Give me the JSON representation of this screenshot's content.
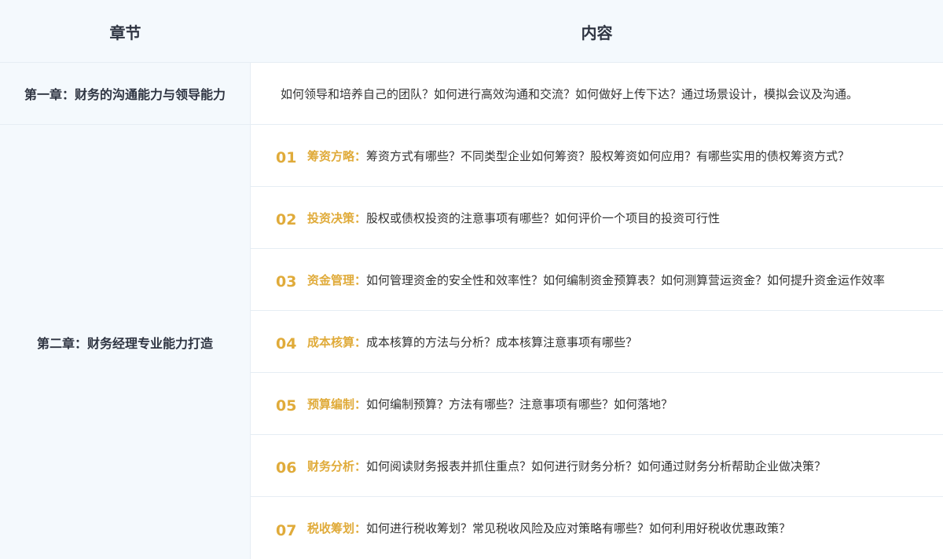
{
  "header": {
    "chapter_label": "章节",
    "content_label": "内容"
  },
  "chapters": [
    {
      "title": "第一章：财务的沟通能力与领导能力",
      "content": "如何领导和培养自己的团队？如何进行高效沟通和交流？如何做好上传下达？通过场景设计，模拟会议及沟通。"
    },
    {
      "title": "第二章：财务经理专业能力打造",
      "items": [
        {
          "num": "01",
          "topic": "筹资方略：",
          "desc": "筹资方式有哪些？不同类型企业如何筹资？股权筹资如何应用？有哪些实用的债权筹资方式？"
        },
        {
          "num": "02",
          "topic": "投资决策：",
          "desc": "股权或债权投资的注意事项有哪些？如何评价一个项目的投资可行性"
        },
        {
          "num": "03",
          "topic": "资金管理：",
          "desc": "如何管理资金的安全性和效率性？如何编制资金预算表？如何测算营运资金？如何提升资金运作效率"
        },
        {
          "num": "04",
          "topic": "成本核算：",
          "desc": "成本核算的方法与分析？成本核算注意事项有哪些？"
        },
        {
          "num": "05",
          "topic": "预算编制：",
          "desc": "如何编制预算？方法有哪些？注意事项有哪些？如何落地？"
        },
        {
          "num": "06",
          "topic": "财务分析：",
          "desc": "如何阅读财务报表并抓住重点？如何进行财务分析？如何通过财务分析帮助企业做决策？"
        },
        {
          "num": "07",
          "topic": "税收筹划：",
          "desc": "如何进行税收筹划？常见税收风险及应对策略有哪些？如何利用好税收优惠政策？"
        }
      ]
    }
  ],
  "colors": {
    "header_bg": "#f4f9fd",
    "accent": "#e0ab3a",
    "border": "#e6edf4",
    "heading_text": "#2f3542"
  }
}
